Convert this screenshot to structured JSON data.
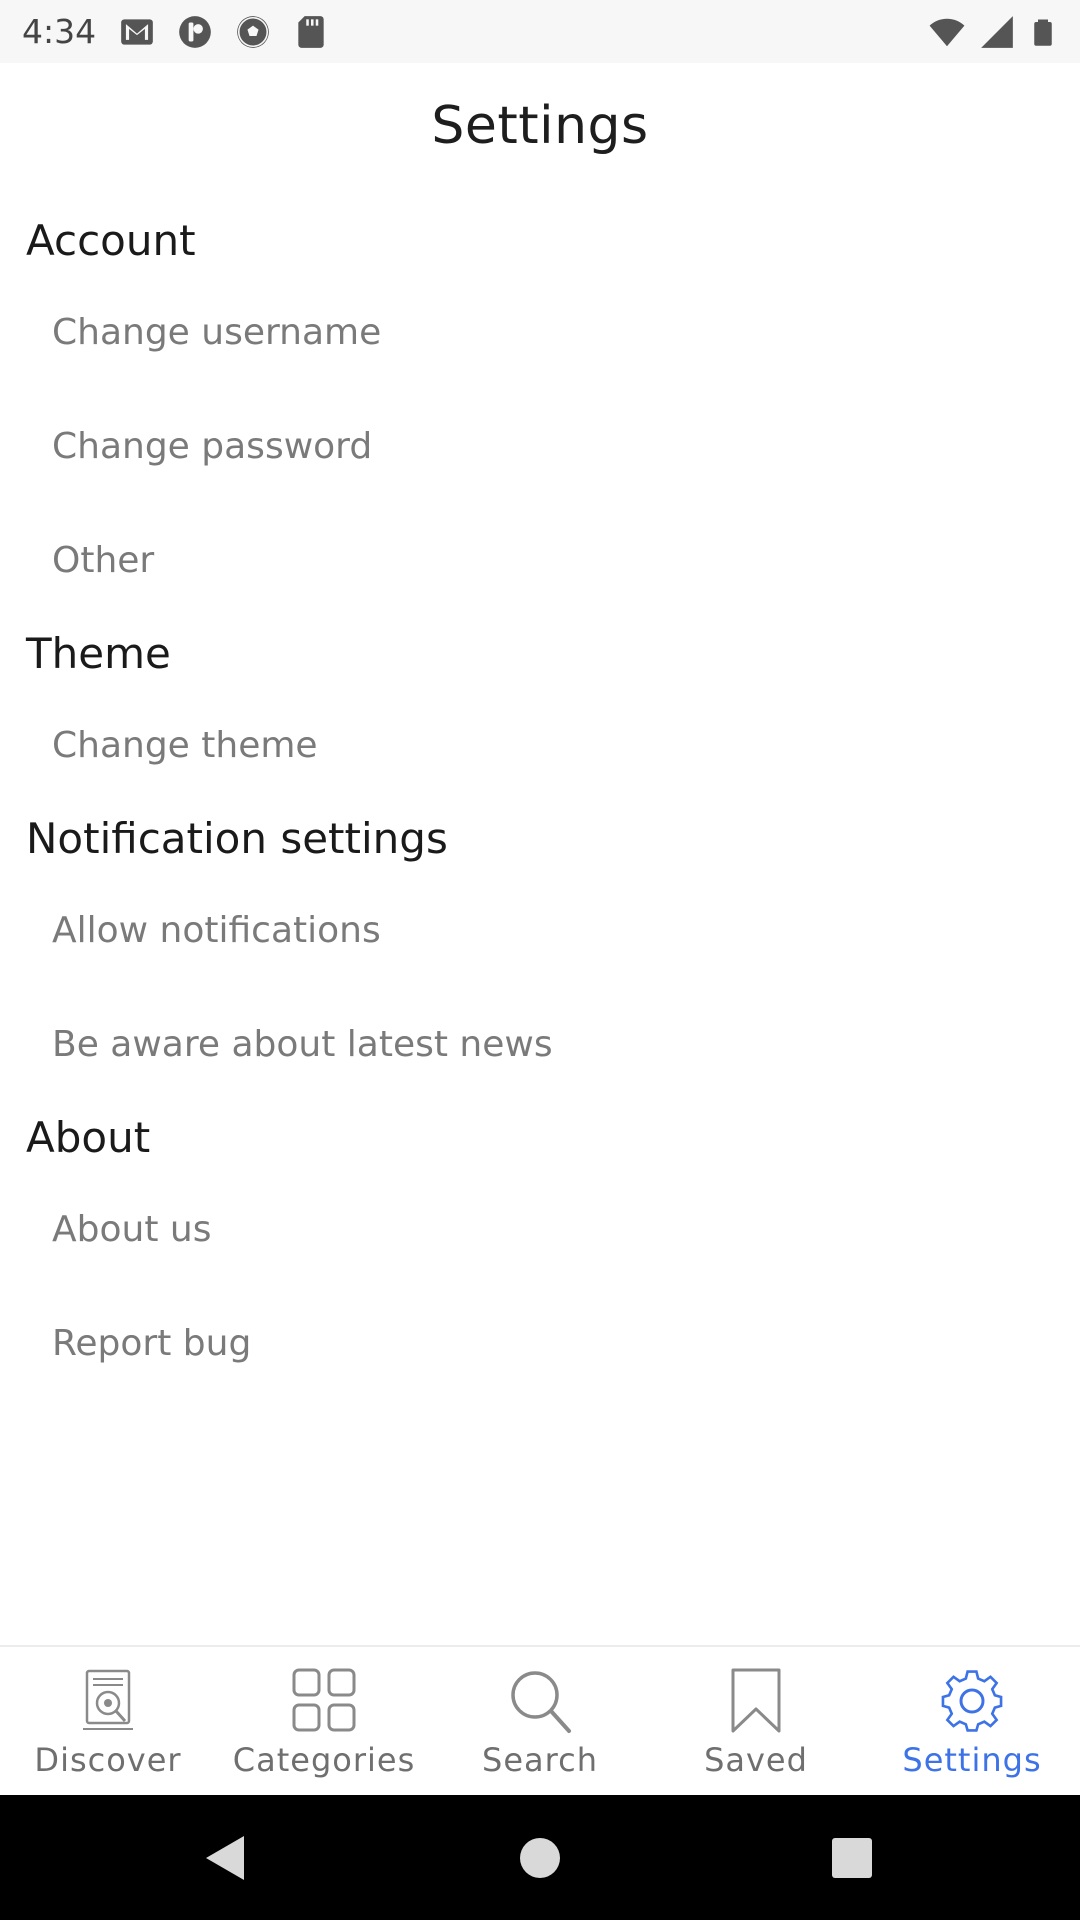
{
  "status_bar": {
    "time": "4:34",
    "left_icons": [
      "gmail-icon",
      "app-icon",
      "soccer-ball-icon",
      "sd-card-icon"
    ],
    "right_icons": [
      "wifi-icon",
      "cell-signal-icon",
      "battery-icon"
    ]
  },
  "header": {
    "title": "Settings"
  },
  "sections": [
    {
      "title": "Account",
      "items": [
        "Change username",
        "Change password",
        "Other"
      ]
    },
    {
      "title": "Theme",
      "items": [
        "Change theme"
      ]
    },
    {
      "title": "Notification settings",
      "items": [
        "Allow notifications",
        "Be aware about latest news"
      ]
    },
    {
      "title": "About",
      "items": [
        "About us",
        "Report bug"
      ]
    }
  ],
  "bottom_nav": {
    "items": [
      {
        "label": "Discover",
        "icon": "discover-icon"
      },
      {
        "label": "Categories",
        "icon": "categories-icon"
      },
      {
        "label": "Search",
        "icon": "search-icon"
      },
      {
        "label": "Saved",
        "icon": "bookmark-icon"
      },
      {
        "label": "Settings",
        "icon": "gear-icon"
      }
    ],
    "active": "Settings"
  },
  "colors": {
    "accent": "#3d73e6",
    "section_text": "#1a1a1a",
    "item_text": "#7a7a7a",
    "nav_inactive": "#6f6f6f"
  },
  "system_nav": [
    "back-icon",
    "home-icon",
    "recents-icon"
  ]
}
